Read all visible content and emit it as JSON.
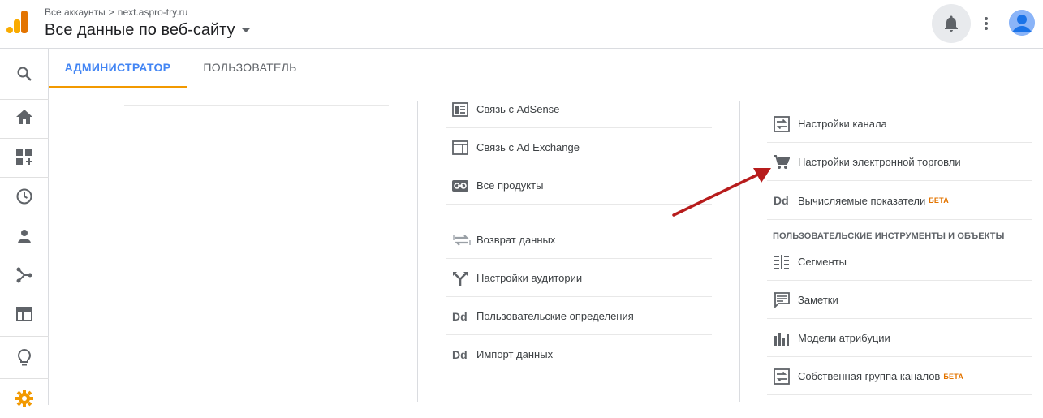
{
  "header": {
    "breadcrumb_root": "Все аккаунты",
    "breadcrumb_sep": ">",
    "breadcrumb_account": "next.aspro-try.ru",
    "view_title": "Все данные по веб-сайту"
  },
  "tabs": [
    {
      "label": "АДМИНИСТРАТОР",
      "active": true
    },
    {
      "label": "ПОЛЬЗОВАТЕЛЬ",
      "active": false
    }
  ],
  "nav": {
    "items": [
      "search",
      "home",
      "customization",
      "realtime",
      "audience",
      "acquisition",
      "behavior",
      "discover",
      "admin"
    ]
  },
  "property_column": {
    "items": [
      {
        "label": "Связь с AdSense",
        "icon": "adsense-icon"
      },
      {
        "label": "Связь с Ad Exchange",
        "icon": "ad-exchange-icon"
      },
      {
        "label": "Все продукты",
        "icon": "link-icon"
      },
      {
        "label": "Возврат данных",
        "icon": "data-retention-icon"
      },
      {
        "label": "Настройки аудитории",
        "icon": "audience-settings-icon"
      },
      {
        "label": "Пользовательские определения",
        "icon": "dd-icon"
      },
      {
        "label": "Импорт данных",
        "icon": "dd-icon"
      }
    ]
  },
  "view_column": {
    "items": [
      {
        "label": "Настройки канала",
        "icon": "channel-settings-icon"
      },
      {
        "label": "Настройки электронной торговли",
        "icon": "cart-icon"
      },
      {
        "label": "Вычисляемые показатели",
        "badge": "БЕТА",
        "icon": "dd-icon"
      }
    ],
    "section_title": "ПОЛЬЗОВАТЕЛЬСКИЕ ИНСТРУМЕНТЫ И ОБЪЕКТЫ",
    "tools": [
      {
        "label": "Сегменты",
        "icon": "segments-icon"
      },
      {
        "label": "Заметки",
        "icon": "annotations-icon"
      },
      {
        "label": "Модели атрибуции",
        "icon": "attribution-icon"
      },
      {
        "label": "Собственная группа каналов",
        "badge": "БЕТА",
        "icon": "channel-group-icon"
      }
    ]
  },
  "icon_text": {
    "dd": "Dd"
  },
  "colors": {
    "accent": "#4285f4",
    "tab_underline": "#f29900",
    "beta": "#e37400",
    "annotation_arrow": "#b71c1c",
    "admin_gear": "#f29900"
  }
}
